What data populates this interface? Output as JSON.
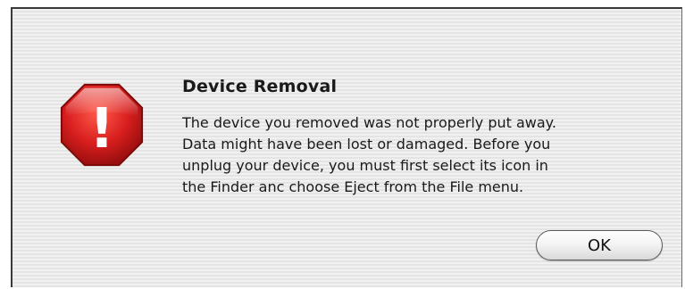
{
  "dialog": {
    "title": "Device Removal",
    "message_lines": [
      "The device you removed was not properly put away.",
      "Data might have been lost or damaged.  Before you",
      "unplug your device, you must first select its icon in",
      "the Finder anc choose Eject from the File menu."
    ],
    "ok_label": "OK",
    "icon": "stop-alert-icon",
    "icon_color": "#d81e1e",
    "accent_glyph": "!"
  }
}
